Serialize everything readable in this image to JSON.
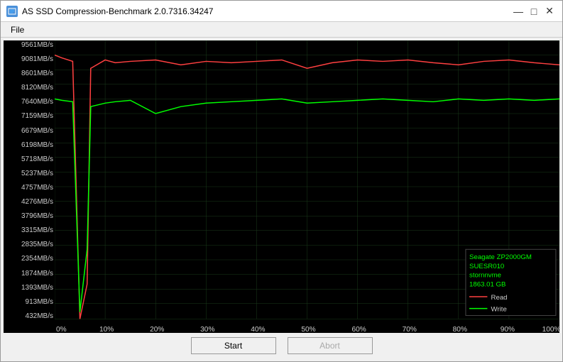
{
  "window": {
    "title": "AS SSD Compression-Benchmark 2.0.7316.34247",
    "icon": "ssd-icon"
  },
  "menu": {
    "items": [
      "File"
    ]
  },
  "chart": {
    "y_labels": [
      "9561MB/s",
      "9081MB/s",
      "8601MB/s",
      "8120MB/s",
      "7640MB/s",
      "7159MB/s",
      "6679MB/s",
      "6198MB/s",
      "5718MB/s",
      "5237MB/s",
      "4757MB/s",
      "4276MB/s",
      "3796MB/s",
      "3315MB/s",
      "2835MB/s",
      "2354MB/s",
      "1874MB/s",
      "1393MB/s",
      "913MB/s",
      "432MB/s"
    ],
    "x_labels": [
      "0%",
      "10%",
      "20%",
      "30%",
      "40%",
      "50%",
      "60%",
      "70%",
      "80%",
      "90%",
      "100%"
    ],
    "legend": {
      "drive": "Seagate ZP2000GM",
      "model": "SUESR010",
      "driver": "stornnvme",
      "size": "1863.01 GB",
      "read_label": "Read",
      "write_label": "Write",
      "read_color": "#ff4444",
      "write_color": "#00ff00"
    }
  },
  "buttons": {
    "start_label": "Start",
    "abort_label": "Abort"
  },
  "title_controls": {
    "minimize": "—",
    "maximize": "□",
    "close": "✕"
  }
}
